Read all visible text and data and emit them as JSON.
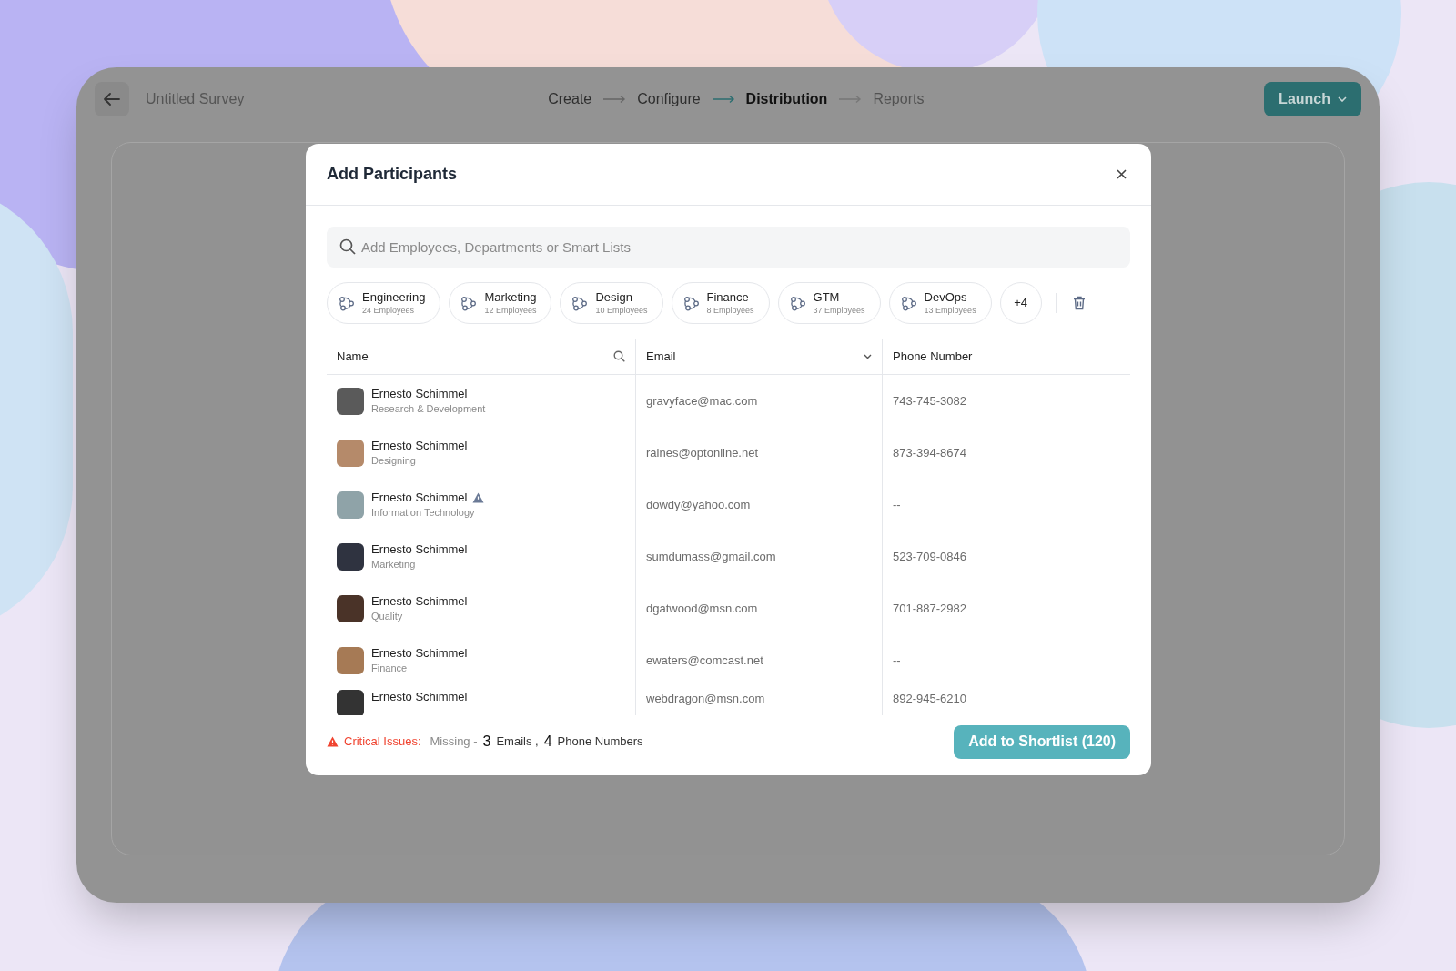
{
  "topbar": {
    "title": "Untitled Survey",
    "launch_label": "Launch"
  },
  "steps": [
    {
      "label": "Create",
      "selected": false,
      "disabled": false
    },
    {
      "label": "Configure",
      "selected": false,
      "disabled": false
    },
    {
      "label": "Distribution",
      "selected": true,
      "disabled": false
    },
    {
      "label": "Reports",
      "selected": false,
      "disabled": true
    }
  ],
  "modal": {
    "title": "Add Participants",
    "search": {
      "placeholder": "Add Employees, Departments or Smart Lists"
    },
    "chips": [
      {
        "name": "Engineering",
        "count": "24 Employees"
      },
      {
        "name": "Marketing",
        "count": "12 Employees"
      },
      {
        "name": "Design",
        "count": "10 Employees"
      },
      {
        "name": "Finance",
        "count": "8 Employees"
      },
      {
        "name": "GTM",
        "count": "37 Employees"
      },
      {
        "name": "DevOps",
        "count": "13 Employees"
      }
    ],
    "more_chips": "+4",
    "table": {
      "columns": [
        "Name",
        "Email",
        "Phone Number"
      ],
      "rows": [
        {
          "name": "Ernesto Schimmel",
          "department": "Research & Development",
          "email": "gravyface@mac.com",
          "phone": "743-745-3082",
          "warning": false
        },
        {
          "name": "Ernesto Schimmel",
          "department": "Designing",
          "email": "raines@optonline.net",
          "phone": "873-394-8674",
          "warning": false
        },
        {
          "name": "Ernesto Schimmel",
          "department": "Information Technology",
          "email": "dowdy@yahoo.com",
          "phone": "--",
          "warning": true
        },
        {
          "name": "Ernesto Schimmel",
          "department": "Marketing",
          "email": "sumdumass@gmail.com",
          "phone": "523-709-0846",
          "warning": false
        },
        {
          "name": "Ernesto Schimmel",
          "department": "Quality",
          "email": "dgatwood@msn.com",
          "phone": "701-887-2982",
          "warning": false
        },
        {
          "name": "Ernesto Schimmel",
          "department": "Finance",
          "email": "ewaters@comcast.net",
          "phone": "--",
          "warning": false
        },
        {
          "name": "Ernesto Schimmel",
          "email": "webdragon@msn.com",
          "phone": "892-945-6210",
          "warning": false
        }
      ]
    },
    "footer": {
      "issues_label": "Critical Issues:",
      "missing_label": "Missing -",
      "email_count": "3",
      "email_label": "Emails ,",
      "phone_count": "4",
      "phone_label": "Phone Numbers"
    },
    "primary_button": "Add to Shortlist (120)"
  }
}
